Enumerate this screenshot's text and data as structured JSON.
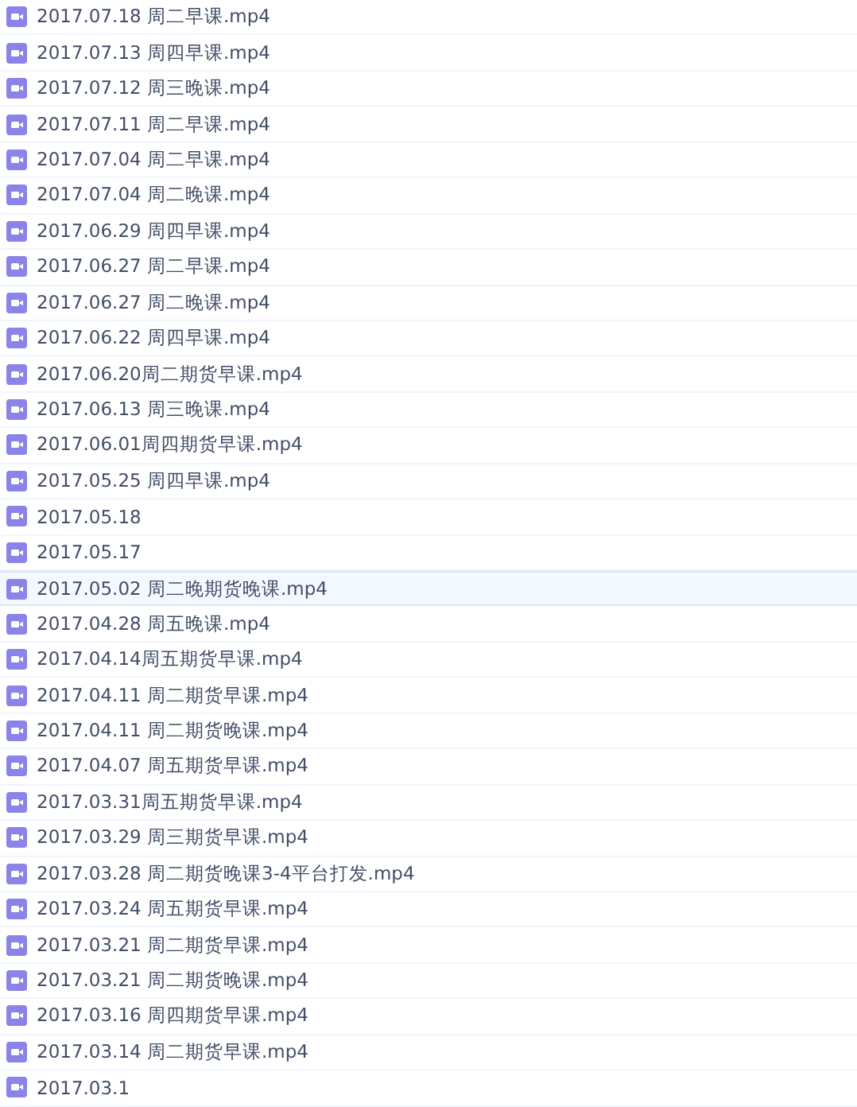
{
  "files": [
    {
      "name": "2017.07.18 周二早课.mp4",
      "selected": false
    },
    {
      "name": "2017.07.13 周四早课.mp4",
      "selected": false
    },
    {
      "name": "2017.07.12 周三晚课.mp4",
      "selected": false
    },
    {
      "name": "2017.07.11 周二早课.mp4",
      "selected": false
    },
    {
      "name": "2017.07.04 周二早课.mp4",
      "selected": false
    },
    {
      "name": "2017.07.04 周二晚课.mp4",
      "selected": false
    },
    {
      "name": "2017.06.29 周四早课.mp4",
      "selected": false
    },
    {
      "name": "2017.06.27 周二早课.mp4",
      "selected": false
    },
    {
      "name": "2017.06.27 周二晚课.mp4",
      "selected": false
    },
    {
      "name": "2017.06.22 周四早课.mp4",
      "selected": false
    },
    {
      "name": "2017.06.20周二期货早课.mp4",
      "selected": false
    },
    {
      "name": "2017.06.13 周三晚课.mp4",
      "selected": false
    },
    {
      "name": "2017.06.01周四期货早课.mp4",
      "selected": false
    },
    {
      "name": "2017.05.25 周四早课.mp4",
      "selected": false
    },
    {
      "name": "2017.05.18",
      "selected": false
    },
    {
      "name": "2017.05.17",
      "selected": false
    },
    {
      "name": "2017.05.02 周二晚期货晚课.mp4",
      "selected": true
    },
    {
      "name": "2017.04.28 周五晚课.mp4",
      "selected": false
    },
    {
      "name": "2017.04.14周五期货早课.mp4",
      "selected": false
    },
    {
      "name": "2017.04.11 周二期货早课.mp4",
      "selected": false
    },
    {
      "name": "2017.04.11 周二期货晚课.mp4",
      "selected": false
    },
    {
      "name": "2017.04.07 周五期货早课.mp4",
      "selected": false
    },
    {
      "name": "2017.03.31周五期货早课.mp4",
      "selected": false
    },
    {
      "name": "2017.03.29 周三期货早课.mp4",
      "selected": false
    },
    {
      "name": "2017.03.28 周二期货晚课3-4平台打发.mp4",
      "selected": false
    },
    {
      "name": "2017.03.24 周五期货早课.mp4",
      "selected": false
    },
    {
      "name": "2017.03.21 周二期货早课.mp4",
      "selected": false
    },
    {
      "name": "2017.03.21 周二期货晚课.mp4",
      "selected": false
    },
    {
      "name": "2017.03.16 周四期货早课.mp4",
      "selected": false
    },
    {
      "name": "2017.03.14 周二期货早课.mp4",
      "selected": false
    },
    {
      "name": "2017.03.1",
      "selected": false
    }
  ]
}
